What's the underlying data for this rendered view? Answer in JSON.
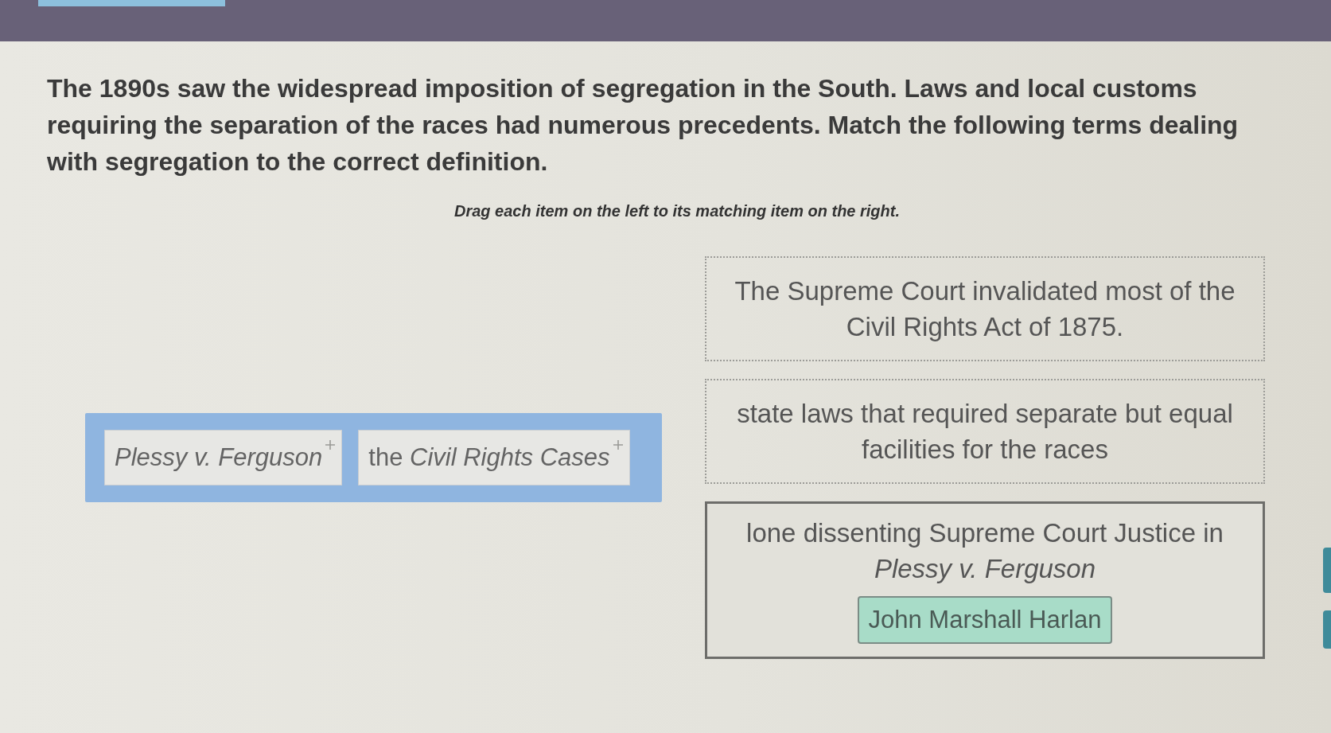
{
  "question": {
    "text": "The 1890s saw the widespread imposition of segregation in the South. Laws and local customs requiring the separation of the races had numerous precedents. Match the following terms dealing with segregation to the correct definition.",
    "instruction": "Drag each item on the left to its matching item on the right."
  },
  "terms": [
    {
      "kind": "case",
      "label": "Plessy v. Ferguson"
    },
    {
      "kind": "phrase",
      "label": "the *Civil Rights Cases*"
    }
  ],
  "targets": [
    {
      "definition": "The Supreme Court invalidated most of the Civil Rights Act of 1875."
    },
    {
      "definition": "state laws that required separate but equal facilities for the races"
    },
    {
      "definition": "lone dissenting Supreme Court Justice in *Plessy v. Ferguson*",
      "answer": "John Marshall Harlan"
    }
  ]
}
